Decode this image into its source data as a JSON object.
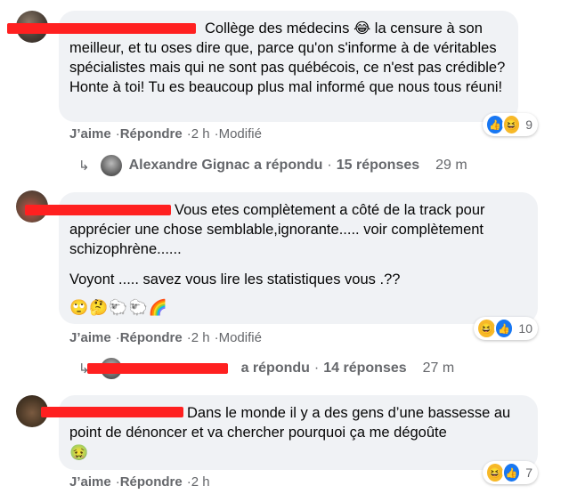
{
  "comments": [
    {
      "text_before_name": "",
      "name_tag": "Collège des médecins",
      "text": " la censure à son meilleur, et tu oses dire que, parce qu'on s'informe à de véritables spécialistes mais qui ne sont pas québécois, ce n'est pas crédible? Honte à toi! Tu es beaucoup plus mal informé que nous tous réuni!",
      "inline_emoji": "😂",
      "actions": {
        "like": "J’aime",
        "reply": "Répondre",
        "time": "2 h",
        "edited": "Modifié"
      },
      "reactions": {
        "icons": [
          "like",
          "haha"
        ],
        "count": "9"
      },
      "replies": {
        "name": "Alexandre Gignac",
        "verb": "a répondu",
        "count_label": "15 réponses",
        "time": "29 m"
      }
    },
    {
      "text": "Vous etes complètement a côté de la track pour apprécier une chose semblable,ignorante..... voir complètement schizophrène......",
      "text2": "Voyont ..... savez vous lire les statistiques vous .??",
      "emoji_line": "🙄🤔🐑🐑🌈",
      "actions": {
        "like": "J’aime",
        "reply": "Répondre",
        "time": "2 h",
        "edited": "Modifié"
      },
      "reactions": {
        "icons": [
          "haha",
          "like"
        ],
        "count": "10"
      },
      "replies": {
        "verb": "a répondu",
        "count_label": "14 réponses",
        "time": "27 m"
      }
    },
    {
      "text": "Dans le monde il y a des gens d’une bassesse au point de dénoncer et va chercher pourquoi ça me dégoûte",
      "emoji_line": "🤢",
      "actions": {
        "like": "J’aime",
        "reply": "Répondre",
        "time": "2 h"
      },
      "reactions": {
        "icons": [
          "haha",
          "like"
        ],
        "count": "7"
      }
    }
  ],
  "glyphs": {
    "separator": "·",
    "reply_arrow": "↳"
  },
  "colors": {
    "bubble": "#f0f2f5",
    "meta": "#65676b",
    "like": "#1877f2",
    "haha": "#f7b928",
    "redaction": "#ff2020"
  }
}
